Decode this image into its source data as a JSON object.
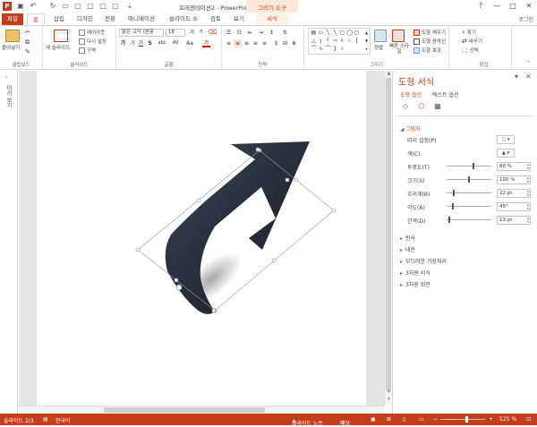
{
  "titlebar": {
    "logo": "P",
    "title": "프레젠테이션2 - PowerPoint",
    "context_group": "그리기 도구",
    "buttons": {
      "help": "?",
      "restore": "❐",
      "minimize": "—",
      "maximize": "□",
      "close": "✕"
    }
  },
  "tabs": [
    {
      "label": "파일"
    },
    {
      "label": "홈"
    },
    {
      "label": "삽입"
    },
    {
      "label": "디자인"
    },
    {
      "label": "전환"
    },
    {
      "label": "애니메이션"
    },
    {
      "label": "슬라이드 쇼"
    },
    {
      "label": "검토"
    },
    {
      "label": "보기"
    },
    {
      "label": "서식"
    }
  ],
  "login": "로그인",
  "ribbon": {
    "clipboard": {
      "label": "클립보드",
      "paste": "붙여넣기"
    },
    "slides": {
      "label": "슬라이드",
      "new_slide": "새 슬라이드",
      "layout": "레이아웃",
      "reset": "다시 설정",
      "section": "구역"
    },
    "font": {
      "label": "글꼴",
      "font_name": "맑은 고딕 (본문",
      "font_size": "18",
      "bold": "가",
      "italic": "가",
      "underline": "가",
      "strike": "S",
      "shadow": "abc",
      "spacing": "AV",
      "case": "Aa",
      "grow": "가",
      "shrink": "가",
      "color": "가"
    },
    "paragraph": {
      "label": "단락"
    },
    "drawing": {
      "label": "그리기",
      "arrange": "정렬",
      "quick_styles": "빠른 스타일",
      "fill": "도형 채우기",
      "outline": "도형 윤곽선",
      "effects": "도형 효과"
    },
    "editing": {
      "label": "편집",
      "find": "찾기",
      "replace": "바꾸기",
      "select": "선택"
    }
  },
  "leftrail": {
    "label": "미리 보기"
  },
  "pane": {
    "title": "도형 서식",
    "tabs": [
      {
        "label": "도형 옵션"
      },
      {
        "label": "텍스트 옵션"
      }
    ],
    "sections": {
      "shadow": "그림자",
      "reflection": "반사",
      "glow": "네온",
      "soft_edges": "부드러운 가장자리",
      "format_3d": "3차원 서식",
      "rotation_3d": "3차원 회전"
    },
    "shadow_props": [
      {
        "label": "미리 설정(P)",
        "kind": "swatch"
      },
      {
        "label": "색(C)",
        "kind": "color"
      },
      {
        "label": "투명도(T)",
        "value": "60 %",
        "level": 0.6
      },
      {
        "label": "크기(S)",
        "value": "100 %",
        "level": 0.5
      },
      {
        "label": "흐리게(B)",
        "value": "22 pt",
        "level": 0.15
      },
      {
        "label": "각도(A)",
        "value": "45°",
        "level": 0.12
      },
      {
        "label": "간격(D)",
        "value": "13 pt",
        "level": 0.05
      }
    ]
  },
  "status": {
    "slide_info": "슬라이드 2/3",
    "language": "한국어",
    "notes": "슬라이드 노트",
    "comments": "메모",
    "zoom": "125 %"
  },
  "colors": {
    "accent": "#c43e1c",
    "shape_fill": "#27303f"
  }
}
